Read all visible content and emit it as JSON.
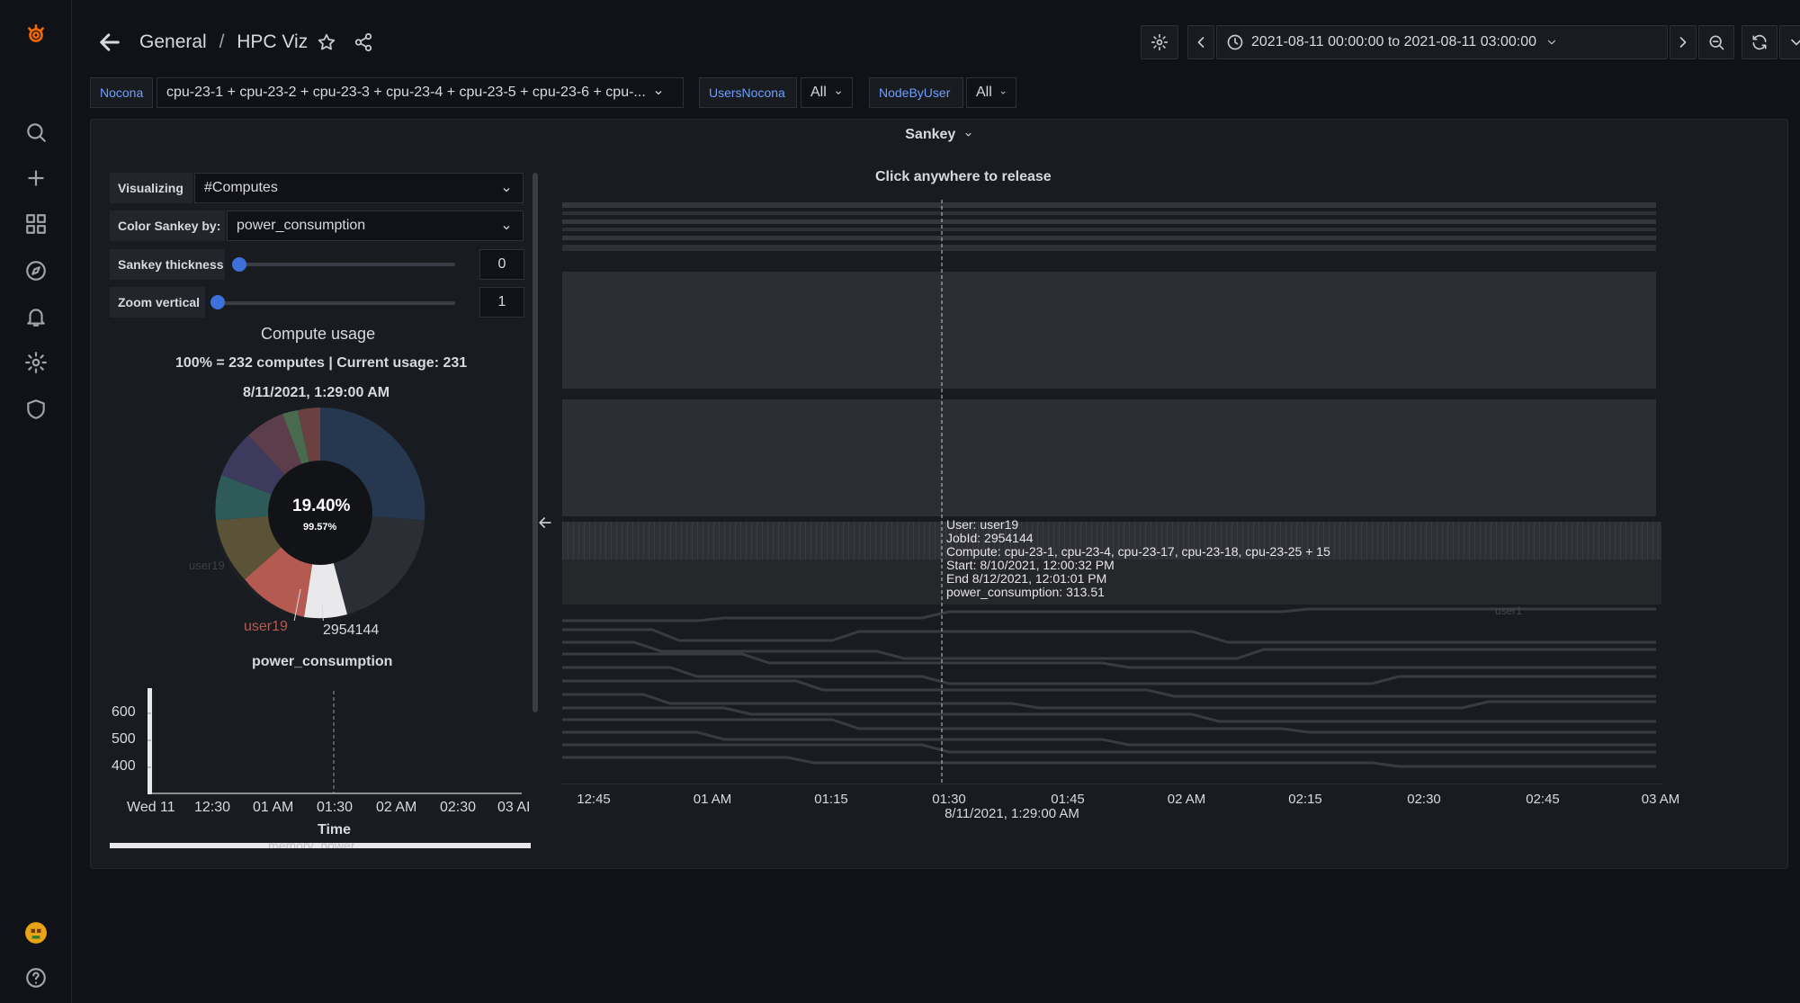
{
  "breadcrumb": {
    "folder": "General",
    "separator": "/",
    "dashboard": "HPC Viz"
  },
  "time_range": {
    "label": "2021-08-11 00:00:00 to 2021-08-11 03:00:00"
  },
  "variables": [
    {
      "label": "Nocona",
      "value": "cpu-23-1 + cpu-23-2 + cpu-23-3 + cpu-23-4 + cpu-23-5 + cpu-23-6 + cpu-..."
    },
    {
      "label": "UsersNocona",
      "value": "All"
    },
    {
      "label": "NodeByUser",
      "value": "All"
    }
  ],
  "panel": {
    "title": "Sankey"
  },
  "controls": {
    "visualizing_label": "Visualizing",
    "visualizing_value": "#Computes",
    "color_by_label": "Color Sankey by:",
    "color_by_value": "power_consumption",
    "thickness_label": "Sankey thickness",
    "thickness_value": "0",
    "zoom_label": "Zoom vertical",
    "zoom_value": "1"
  },
  "compute_usage": {
    "title": "Compute usage",
    "summary": "100% = 232 computes | Current usage: 231",
    "timestamp": "8/11/2021, 1:29:00 AM",
    "center_percent": "19.40%",
    "center_sub": "99.57%",
    "label_user": "user19",
    "label_job": "2954144",
    "faded_user": "user19",
    "metric_label": "power_consumption",
    "highlight_percent": 19.4,
    "usage_percent": 99.57
  },
  "mini_chart": {
    "y_ticks": [
      "600",
      "500",
      "400"
    ],
    "x_ticks": [
      "Wed 11",
      "12:30",
      "01 AM",
      "01:30",
      "02 AM",
      "02:30",
      "03 AI"
    ],
    "xlabel": "Time",
    "bottom_label": "memory_power"
  },
  "sankey": {
    "hint": "Click anywhere to release",
    "x_ticks": [
      "12:45",
      "01 AM",
      "01:15",
      "01:30",
      "01:45",
      "02 AM",
      "02:15",
      "02:30",
      "02:45",
      "03 AM"
    ],
    "cursor_time": "8/11/2021, 1:29:00 AM",
    "faded_label": "user1"
  },
  "tooltip": {
    "user": "User: user19",
    "jobid": "JobId: 2954144",
    "compute": "Compute: cpu-23-1, cpu-23-4, cpu-23-17, cpu-23-18, cpu-23-25 + 15",
    "start": "Start: 8/10/2021, 12:00:32 PM",
    "end": "End 8/12/2021, 12:01:01 PM",
    "power": "power_consumption: 313.51"
  },
  "colors": {
    "background": "#111217",
    "panel": "#181b1f",
    "accent": "#3d71d9",
    "link": "#6e9fff"
  }
}
